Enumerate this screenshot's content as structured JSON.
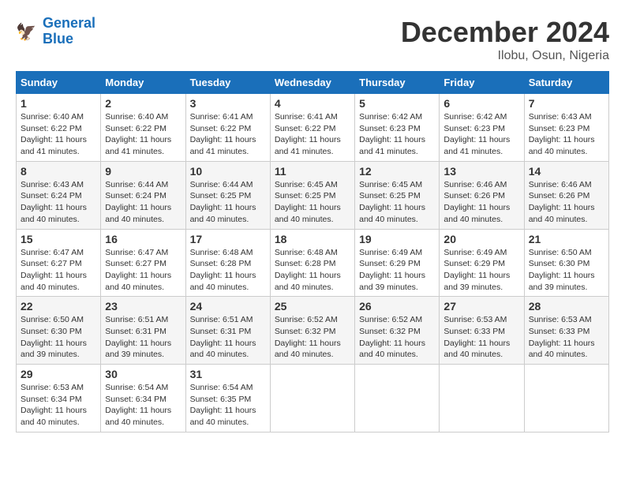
{
  "header": {
    "logo_line1": "General",
    "logo_line2": "Blue",
    "month": "December 2024",
    "location": "Ilobu, Osun, Nigeria"
  },
  "days_of_week": [
    "Sunday",
    "Monday",
    "Tuesday",
    "Wednesday",
    "Thursday",
    "Friday",
    "Saturday"
  ],
  "weeks": [
    [
      {
        "day": "1",
        "info": "Sunrise: 6:40 AM\nSunset: 6:22 PM\nDaylight: 11 hours\nand 41 minutes."
      },
      {
        "day": "2",
        "info": "Sunrise: 6:40 AM\nSunset: 6:22 PM\nDaylight: 11 hours\nand 41 minutes."
      },
      {
        "day": "3",
        "info": "Sunrise: 6:41 AM\nSunset: 6:22 PM\nDaylight: 11 hours\nand 41 minutes."
      },
      {
        "day": "4",
        "info": "Sunrise: 6:41 AM\nSunset: 6:22 PM\nDaylight: 11 hours\nand 41 minutes."
      },
      {
        "day": "5",
        "info": "Sunrise: 6:42 AM\nSunset: 6:23 PM\nDaylight: 11 hours\nand 41 minutes."
      },
      {
        "day": "6",
        "info": "Sunrise: 6:42 AM\nSunset: 6:23 PM\nDaylight: 11 hours\nand 41 minutes."
      },
      {
        "day": "7",
        "info": "Sunrise: 6:43 AM\nSunset: 6:23 PM\nDaylight: 11 hours\nand 40 minutes."
      }
    ],
    [
      {
        "day": "8",
        "info": "Sunrise: 6:43 AM\nSunset: 6:24 PM\nDaylight: 11 hours\nand 40 minutes."
      },
      {
        "day": "9",
        "info": "Sunrise: 6:44 AM\nSunset: 6:24 PM\nDaylight: 11 hours\nand 40 minutes."
      },
      {
        "day": "10",
        "info": "Sunrise: 6:44 AM\nSunset: 6:25 PM\nDaylight: 11 hours\nand 40 minutes."
      },
      {
        "day": "11",
        "info": "Sunrise: 6:45 AM\nSunset: 6:25 PM\nDaylight: 11 hours\nand 40 minutes."
      },
      {
        "day": "12",
        "info": "Sunrise: 6:45 AM\nSunset: 6:25 PM\nDaylight: 11 hours\nand 40 minutes."
      },
      {
        "day": "13",
        "info": "Sunrise: 6:46 AM\nSunset: 6:26 PM\nDaylight: 11 hours\nand 40 minutes."
      },
      {
        "day": "14",
        "info": "Sunrise: 6:46 AM\nSunset: 6:26 PM\nDaylight: 11 hours\nand 40 minutes."
      }
    ],
    [
      {
        "day": "15",
        "info": "Sunrise: 6:47 AM\nSunset: 6:27 PM\nDaylight: 11 hours\nand 40 minutes."
      },
      {
        "day": "16",
        "info": "Sunrise: 6:47 AM\nSunset: 6:27 PM\nDaylight: 11 hours\nand 40 minutes."
      },
      {
        "day": "17",
        "info": "Sunrise: 6:48 AM\nSunset: 6:28 PM\nDaylight: 11 hours\nand 40 minutes."
      },
      {
        "day": "18",
        "info": "Sunrise: 6:48 AM\nSunset: 6:28 PM\nDaylight: 11 hours\nand 40 minutes."
      },
      {
        "day": "19",
        "info": "Sunrise: 6:49 AM\nSunset: 6:29 PM\nDaylight: 11 hours\nand 39 minutes."
      },
      {
        "day": "20",
        "info": "Sunrise: 6:49 AM\nSunset: 6:29 PM\nDaylight: 11 hours\nand 39 minutes."
      },
      {
        "day": "21",
        "info": "Sunrise: 6:50 AM\nSunset: 6:30 PM\nDaylight: 11 hours\nand 39 minutes."
      }
    ],
    [
      {
        "day": "22",
        "info": "Sunrise: 6:50 AM\nSunset: 6:30 PM\nDaylight: 11 hours\nand 39 minutes."
      },
      {
        "day": "23",
        "info": "Sunrise: 6:51 AM\nSunset: 6:31 PM\nDaylight: 11 hours\nand 39 minutes."
      },
      {
        "day": "24",
        "info": "Sunrise: 6:51 AM\nSunset: 6:31 PM\nDaylight: 11 hours\nand 40 minutes."
      },
      {
        "day": "25",
        "info": "Sunrise: 6:52 AM\nSunset: 6:32 PM\nDaylight: 11 hours\nand 40 minutes."
      },
      {
        "day": "26",
        "info": "Sunrise: 6:52 AM\nSunset: 6:32 PM\nDaylight: 11 hours\nand 40 minutes."
      },
      {
        "day": "27",
        "info": "Sunrise: 6:53 AM\nSunset: 6:33 PM\nDaylight: 11 hours\nand 40 minutes."
      },
      {
        "day": "28",
        "info": "Sunrise: 6:53 AM\nSunset: 6:33 PM\nDaylight: 11 hours\nand 40 minutes."
      }
    ],
    [
      {
        "day": "29",
        "info": "Sunrise: 6:53 AM\nSunset: 6:34 PM\nDaylight: 11 hours\nand 40 minutes."
      },
      {
        "day": "30",
        "info": "Sunrise: 6:54 AM\nSunset: 6:34 PM\nDaylight: 11 hours\nand 40 minutes."
      },
      {
        "day": "31",
        "info": "Sunrise: 6:54 AM\nSunset: 6:35 PM\nDaylight: 11 hours\nand 40 minutes."
      },
      {
        "day": "",
        "info": ""
      },
      {
        "day": "",
        "info": ""
      },
      {
        "day": "",
        "info": ""
      },
      {
        "day": "",
        "info": ""
      }
    ]
  ]
}
